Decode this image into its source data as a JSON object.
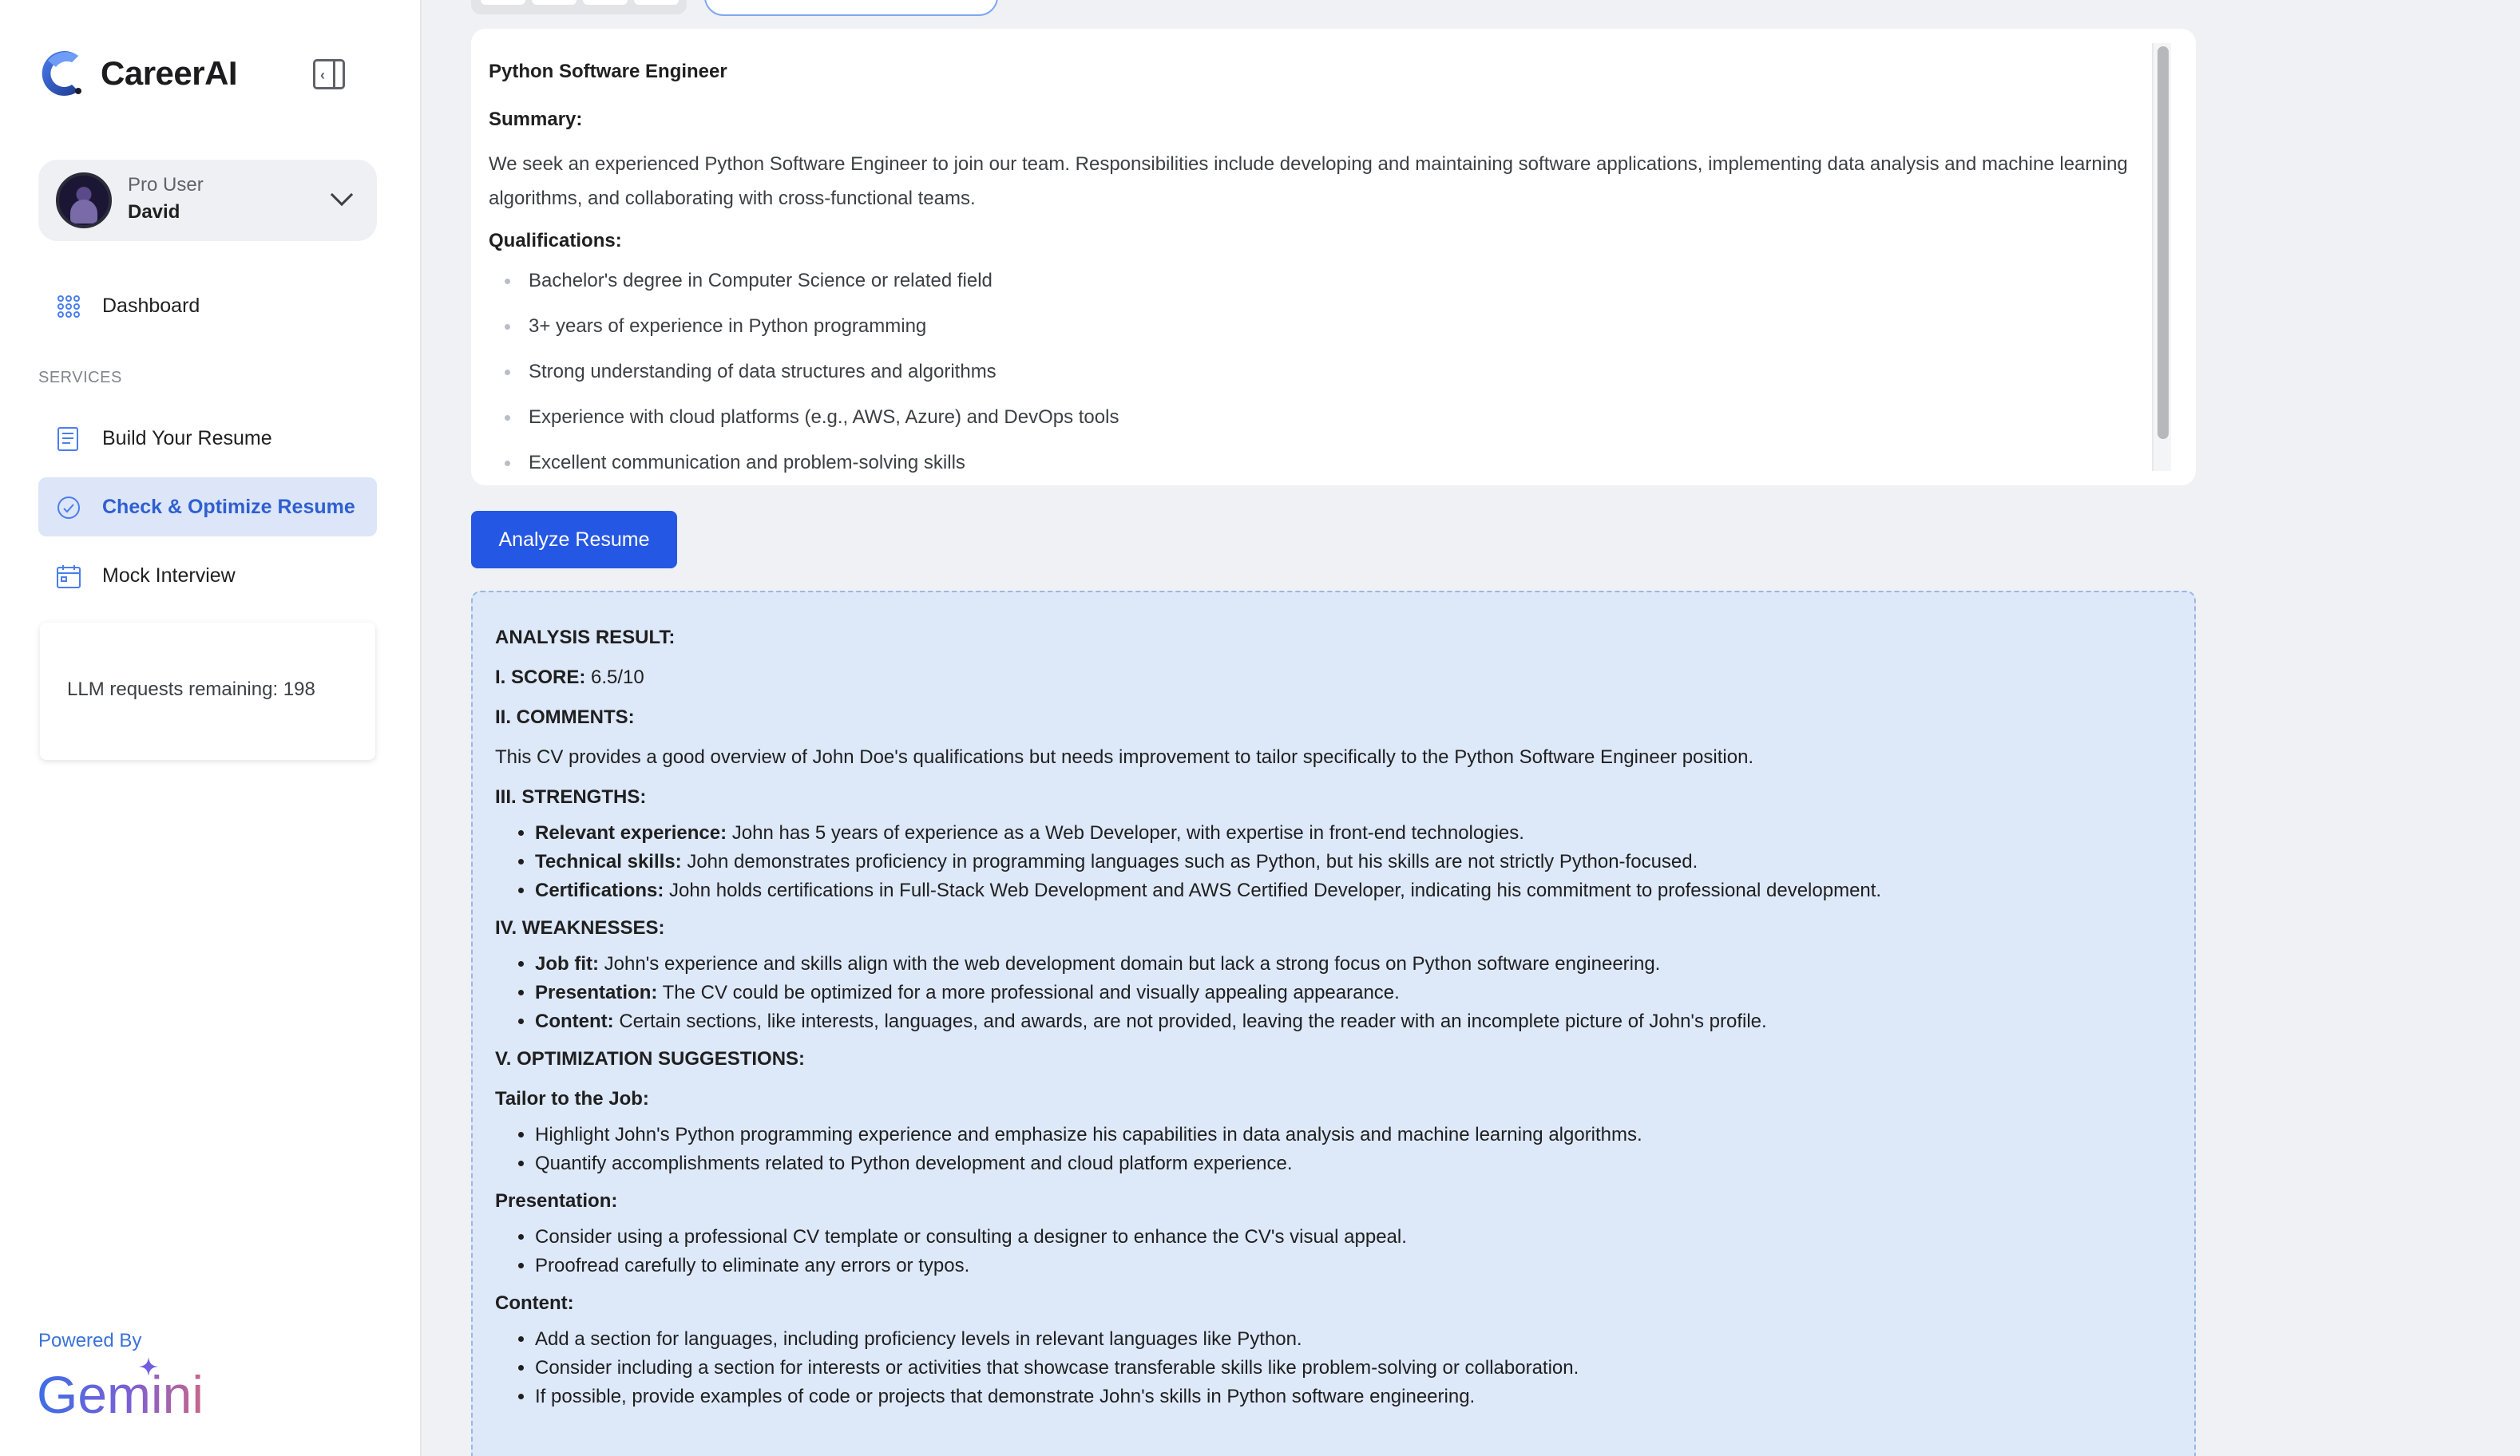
{
  "app": {
    "name": "CareerAI"
  },
  "user": {
    "role": "Pro User",
    "name": "David"
  },
  "nav": {
    "dashboard": "Dashboard",
    "section_label": "SERVICES",
    "build_resume": "Build Your Resume",
    "check_optimize": "Check & Optimize Resume",
    "mock_interview": "Mock Interview"
  },
  "llm": {
    "remaining_text": "LLM requests remaining: 198"
  },
  "footer": {
    "powered_by": "Powered By",
    "brand": "Gemini"
  },
  "job": {
    "title": "Python Software Engineer",
    "summary_heading": "Summary:",
    "summary_text": "We seek an experienced Python Software Engineer to join our team. Responsibilities include developing and maintaining software applications, implementing data analysis and machine learning algorithms, and collaborating with cross-functional teams.",
    "qualifications_heading": "Qualifications:",
    "qualifications": [
      "Bachelor's degree in Computer Science or related field",
      "3+ years of experience in Python programming",
      "Strong understanding of data structures and algorithms",
      "Experience with cloud platforms (e.g., AWS, Azure) and DevOps tools",
      "Excellent communication and problem-solving skills"
    ]
  },
  "actions": {
    "analyze_label": "Analyze Resume"
  },
  "analysis": {
    "heading": "ANALYSIS RESULT:",
    "score_label": "I. SCORE:",
    "score_value": "6.5/10",
    "comments_heading": "II. COMMENTS:",
    "comments_text": "This CV provides a good overview of John Doe's qualifications but needs improvement to tailor specifically to the Python Software Engineer position.",
    "strengths_heading": "III. STRENGTHS:",
    "strengths": [
      {
        "label": "Relevant experience:",
        "text": "John has 5 years of experience as a Web Developer, with expertise in front-end technologies."
      },
      {
        "label": "Technical skills:",
        "text": "John demonstrates proficiency in programming languages such as Python, but his skills are not strictly Python-focused."
      },
      {
        "label": "Certifications:",
        "text": "John holds certifications in Full-Stack Web Development and AWS Certified Developer, indicating his commitment to professional development."
      }
    ],
    "weaknesses_heading": "IV. WEAKNESSES:",
    "weaknesses": [
      {
        "label": "Job fit:",
        "text": "John's experience and skills align with the web development domain but lack a strong focus on Python software engineering."
      },
      {
        "label": "Presentation:",
        "text": "The CV could be optimized for a more professional and visually appealing appearance."
      },
      {
        "label": "Content:",
        "text": "Certain sections, like interests, languages, and awards, are not provided, leaving the reader with an incomplete picture of John's profile."
      }
    ],
    "optimization_heading": "V. OPTIMIZATION SUGGESTIONS:",
    "tailor_heading": "Tailor to the Job:",
    "tailor": [
      "Highlight John's Python programming experience and emphasize his capabilities in data analysis and machine learning algorithms.",
      "Quantify accomplishments related to Python development and cloud platform experience."
    ],
    "presentation_heading": "Presentation:",
    "presentation": [
      "Consider using a professional CV template or consulting a designer to enhance the CV's visual appeal.",
      "Proofread carefully to eliminate any errors or typos."
    ],
    "content_heading": "Content:",
    "content": [
      "Add a section for languages, including proficiency levels in relevant languages like Python.",
      "Consider including a section for interests or activities that showcase transferable skills like problem-solving or collaboration.",
      "If possible, provide examples of code or projects that demonstrate John's skills in Python software engineering."
    ]
  },
  "colors": {
    "accent": "#2457e3",
    "active_nav_bg": "#dce6f8",
    "result_bg": "#dde8f9"
  }
}
